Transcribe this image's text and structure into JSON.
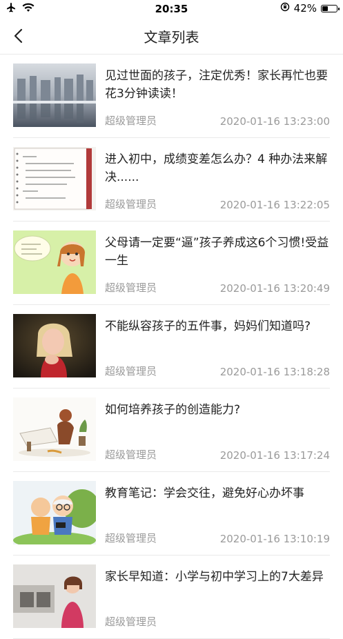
{
  "status_bar": {
    "time": "20:35",
    "battery": "42%",
    "battery_level": 0.42,
    "icons": [
      "airplane-icon",
      "wifi-icon",
      "orientation-lock-icon",
      "battery-icon"
    ]
  },
  "nav": {
    "back_icon": "chevron-left-icon",
    "title": "文章列表"
  },
  "articles": [
    {
      "title": "见过世面的孩子，注定优秀！家长再忙也要花3分钟读读！",
      "author": "超级管理员",
      "date": "2020-01-16 13:23:00",
      "thumb": "city-reflection-image"
    },
    {
      "title": "进入初中，成绩变差怎么办？4 种办法来解决......",
      "author": "超级管理员",
      "date": "2020-01-16 13:22:05",
      "thumb": "notebook-notes-image"
    },
    {
      "title": "父母请一定要“逼”孩子养成这6个习惯!受益一生",
      "author": "超级管理员",
      "date": "2020-01-16 13:20:49",
      "thumb": "cartoon-girl-image"
    },
    {
      "title": "不能纵容孩子的五件事，妈妈们知道吗?",
      "author": "超级管理员",
      "date": "2020-01-16 13:18:28",
      "thumb": "crying-child-image"
    },
    {
      "title": "如何培养孩子的创造能力?",
      "author": "超级管理员",
      "date": "2020-01-16 13:17:24",
      "thumb": "child-painting-illustration"
    },
    {
      "title": "教育笔记：学会交往，避免好心办坏事",
      "author": "超级管理员",
      "date": "2020-01-16 13:10:19",
      "thumb": "elderly-figurines-image"
    },
    {
      "title": "家长早知道：小学与初中学习上的7大差异",
      "author": "超级管理员",
      "date": "",
      "thumb": "girl-classroom-image"
    }
  ]
}
